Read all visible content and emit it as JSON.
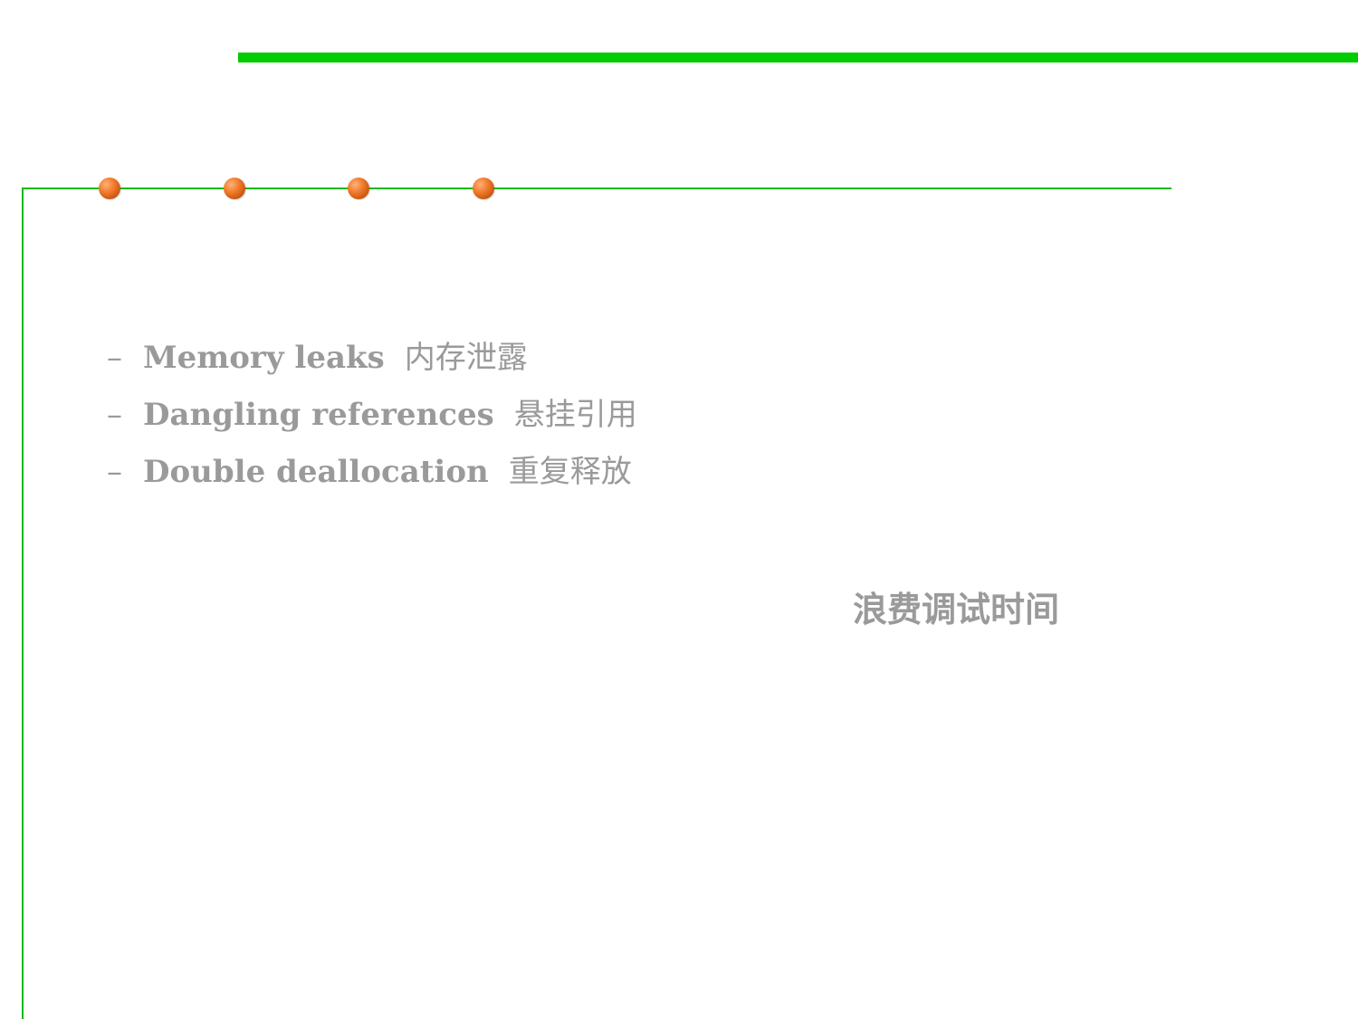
{
  "slide": {
    "bullets": [
      {
        "dash": "–",
        "en": "Memory leaks",
        "cn": "内存泄露"
      },
      {
        "dash": "–",
        "en": "Dangling references",
        "cn": "悬挂引用"
      },
      {
        "dash": "–",
        "en": "Double deallocation",
        "cn": "重复释放"
      }
    ],
    "note": "浪费调试时间"
  },
  "colors": {
    "accent_green": "#00cc00",
    "rule_green": "#18b818",
    "dot_orange": "#f07a2a",
    "text_gray": "#9a9a9a"
  }
}
